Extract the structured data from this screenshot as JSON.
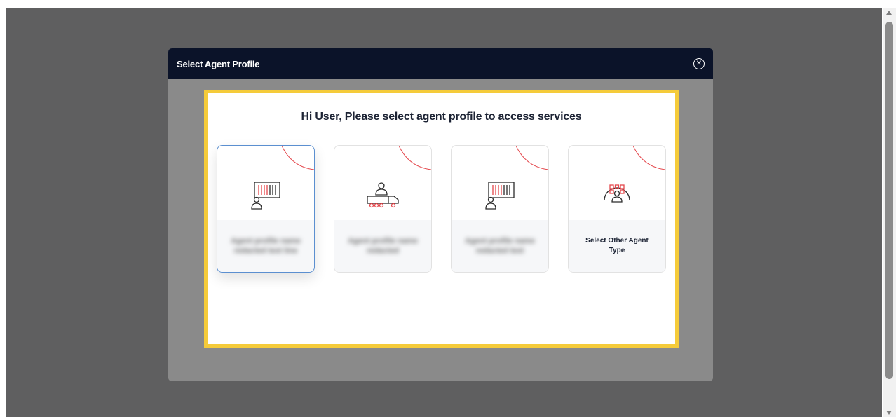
{
  "modal": {
    "title": "Select Agent Profile",
    "close_icon": "close-circle-icon"
  },
  "panel": {
    "greeting": "Hi User, Please select agent profile to access services"
  },
  "cards": [
    {
      "icon": "container-agent-icon",
      "label": "Agent profile name redacted text line",
      "blurred": true,
      "selected": true
    },
    {
      "icon": "truck-agent-icon",
      "label": "Agent profile name redacted",
      "blurred": true,
      "selected": false
    },
    {
      "icon": "container-agent-icon",
      "label": "Agent profile name redacted text",
      "blurred": true,
      "selected": false
    },
    {
      "icon": "network-agent-icon",
      "label": "Select Other Agent Type",
      "blurred": false,
      "selected": false
    }
  ],
  "colors": {
    "header_bg": "#0b1329",
    "highlight_border": "#f5cb3a",
    "selected_border": "#5b8fd0",
    "accent_red": "#e4474c"
  }
}
